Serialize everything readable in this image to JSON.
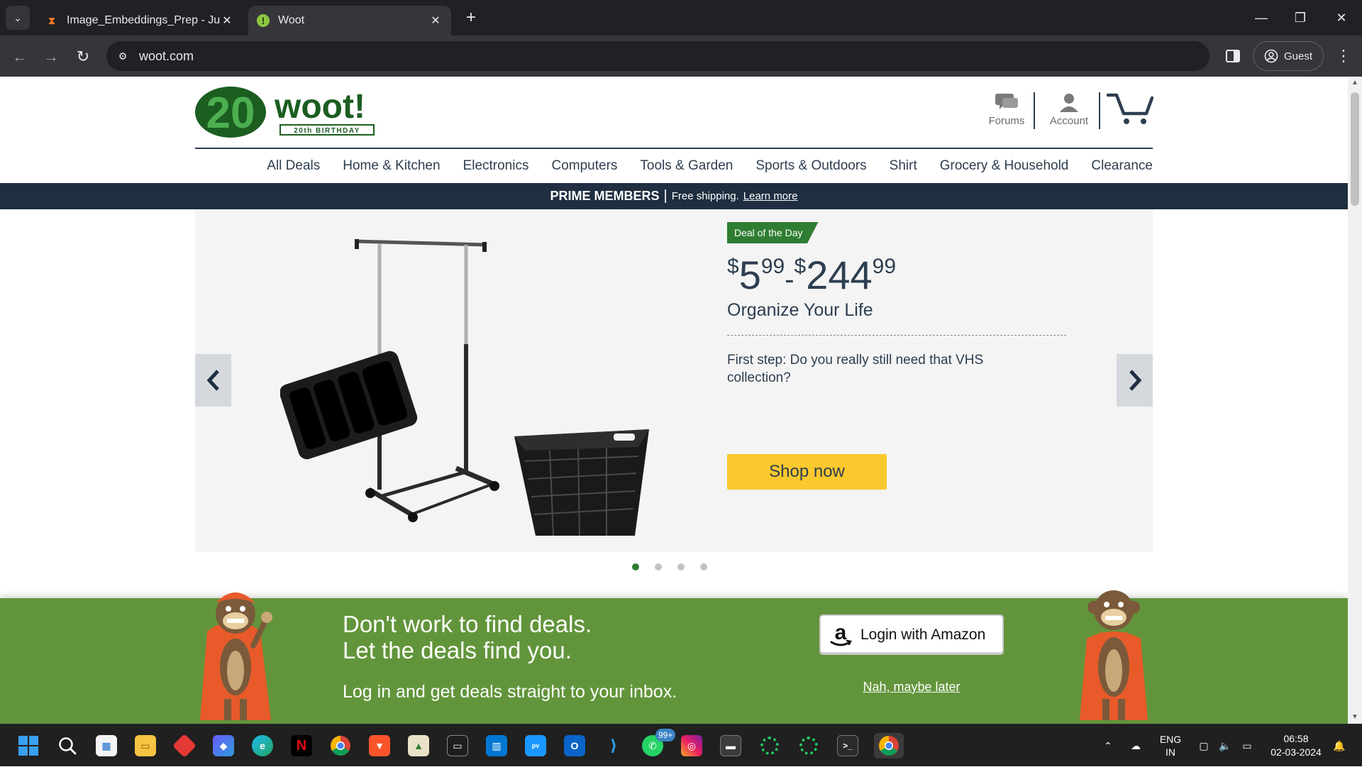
{
  "browser": {
    "tabs": [
      {
        "title": "Image_Embeddings_Prep - Jupyter",
        "favicon": "hourglass-icon",
        "active": false
      },
      {
        "title": "Woot",
        "favicon": "woot-icon",
        "active": true
      }
    ],
    "url": "woot.com",
    "profile_label": "Guest"
  },
  "site": {
    "logo": {
      "number": "20",
      "brand": "woot!",
      "tagline": "20th BIRTHDAY"
    },
    "header_links": {
      "forums": "Forums",
      "account": "Account"
    },
    "nav": [
      "All Deals",
      "Home & Kitchen",
      "Electronics",
      "Computers",
      "Tools & Garden",
      "Sports & Outdoors",
      "Shirt",
      "Grocery & Household",
      "Clearance"
    ],
    "prime_bar": {
      "strong": "PRIME MEMBERS",
      "separator": "|",
      "text": "Free shipping.",
      "link": "Learn more"
    },
    "hero": {
      "badge": "Deal of the Day",
      "price": {
        "sym1": "$",
        "whole1": "5",
        "cents1": "99",
        "dash": "-",
        "sym2": "$",
        "whole2": "244",
        "cents2": "99"
      },
      "title": "Organize Your Life",
      "description": "First step: Do you really still need that VHS collection?",
      "cta": "Shop now",
      "slides_total": 4,
      "active_slide": 1
    },
    "signup": {
      "headline_line1": "Don't work to find deals.",
      "headline_line2": "Let the deals find you.",
      "subtext": "Log in and get deals straight to your inbox.",
      "amazon_button": "Login with Amazon",
      "decline_link": "Nah, maybe later"
    }
  },
  "taskbar": {
    "whatsapp_badge": "99+",
    "language_line1": "ENG",
    "language_line2": "IN",
    "time": "06:58",
    "date": "02-03-2024"
  },
  "colors": {
    "woot_green": "#2e7d32",
    "signup_green": "#62953b",
    "navy": "#1f2e40",
    "shop_yellow": "#fbc82d"
  }
}
